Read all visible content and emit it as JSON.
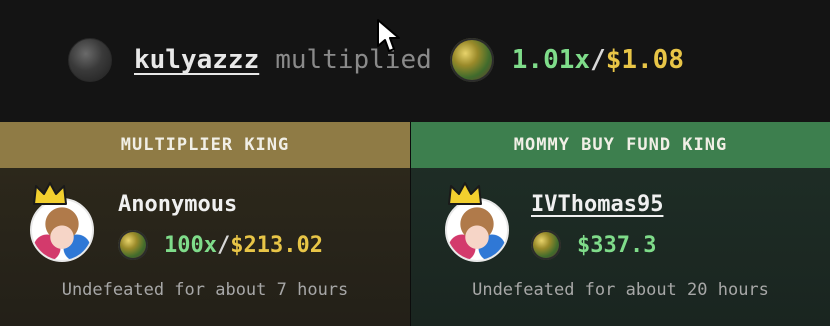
{
  "activity": {
    "username": "kulyazzz",
    "verb": "multiplied",
    "multiplier": "1.01x",
    "slash": "/",
    "amount": "$1.08"
  },
  "cards": {
    "multiplier_king": {
      "header": "MULTIPLIER KING",
      "name": "Anonymous",
      "multiplier": "100x",
      "slash": "/",
      "amount": "$213.02",
      "footer": "Undefeated for about 7 hours"
    },
    "fund_king": {
      "header": "MOMMY BUY FUND KING",
      "name": "IVThomas95",
      "amount": "$337.3",
      "footer": "Undefeated for about 20 hours"
    }
  },
  "colors": {
    "green": "#7fdc8a",
    "gold": "#e8c547",
    "header_gold": "#8f7b45",
    "header_green": "#3d7f4e"
  },
  "icons": {
    "cursor": "mouse-pointer-icon",
    "crown": "crown-icon",
    "coin": "coin-icon"
  }
}
